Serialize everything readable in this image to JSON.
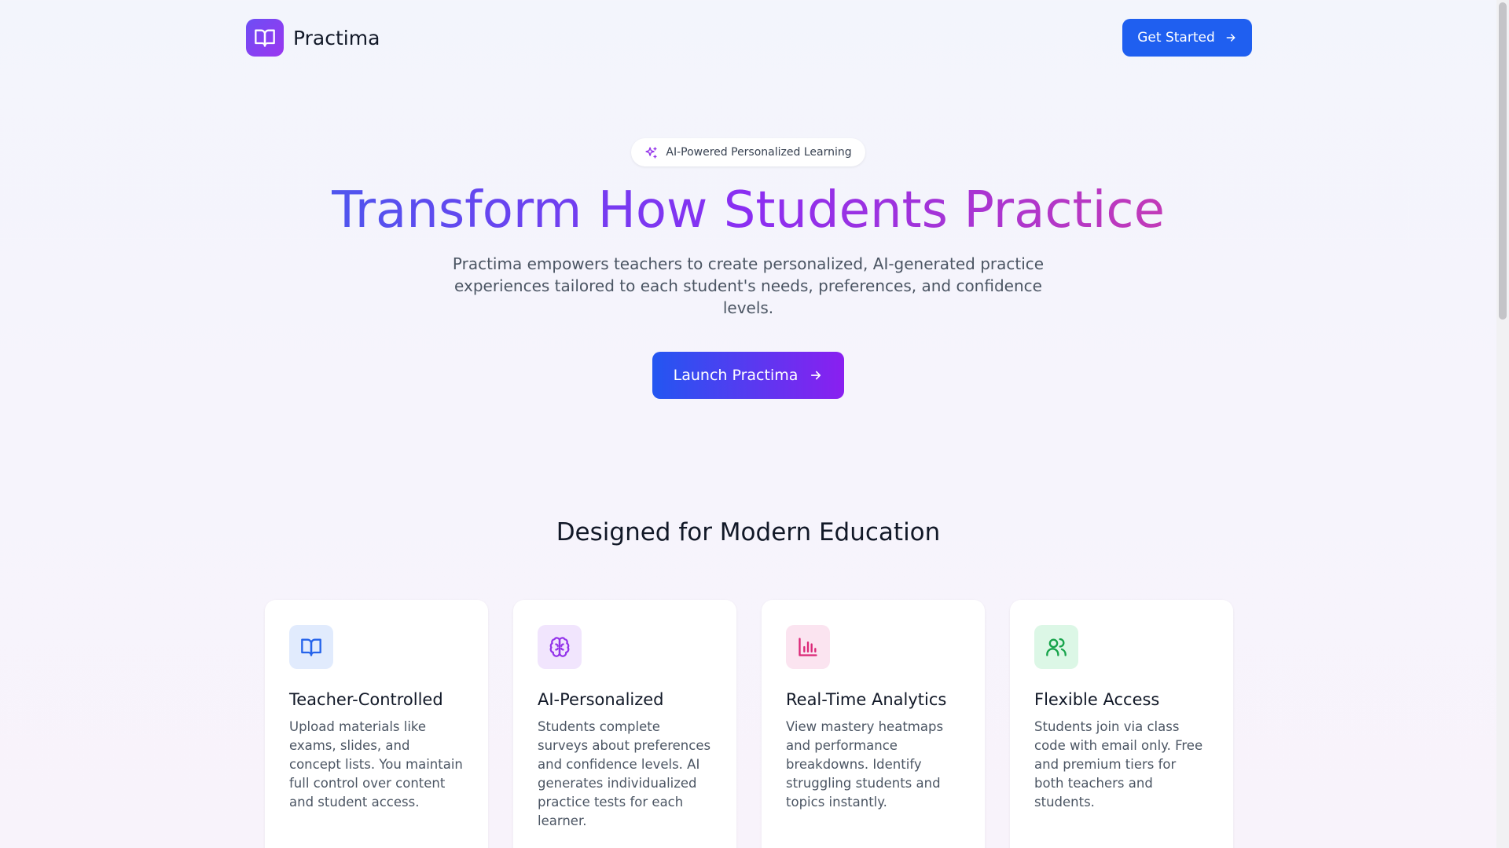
{
  "header": {
    "brand_name": "Practima",
    "get_started_label": "Get Started",
    "logo_icon": "book-open-icon"
  },
  "hero": {
    "badge_text": "AI-Powered Personalized Learning",
    "badge_icon": "sparkles-icon",
    "title": "Transform How Students Practice",
    "subtitle": "Practima empowers teachers to create personalized, AI-generated practice experiences tailored to each student's needs, preferences, and confidence levels.",
    "launch_label": "Launch Practima"
  },
  "features": {
    "section_title": "Designed for Modern Education",
    "cards": [
      {
        "icon": "book-open-icon",
        "title": "Teacher-Controlled",
        "description": "Upload materials like exams, slides, and concept lists. You maintain full control over content and student access.",
        "icon_bg": "#e1ebfd",
        "icon_color": "#2563eb"
      },
      {
        "icon": "brain-icon",
        "title": "AI-Personalized",
        "description": "Students complete surveys about preferences and confidence levels. AI generates individualized practice tests for each learner.",
        "icon_bg": "#f1e5fd",
        "icon_color": "#9333ea"
      },
      {
        "icon": "bar-chart-icon",
        "title": "Real-Time Analytics",
        "description": "View mastery heatmaps and performance breakdowns. Identify struggling students and topics instantly.",
        "icon_bg": "#fbe4f0",
        "icon_color": "#db2777"
      },
      {
        "icon": "users-icon",
        "title": "Flexible Access",
        "description": "Students join via class code with email only. Free and premium tiers for both teachers and students.",
        "icon_bg": "#dcf7e6",
        "icon_color": "#16a34a"
      }
    ]
  },
  "colors": {
    "primary": "#1f5ff0",
    "accent_purple": "#8b2ef2",
    "accent_pink": "#c23ab8"
  }
}
